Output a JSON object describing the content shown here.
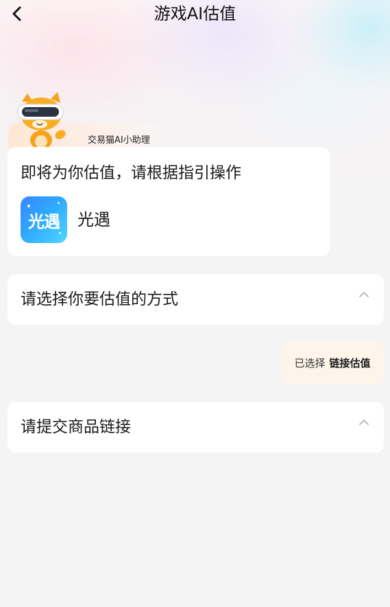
{
  "header": {
    "title": "游戏AI估值",
    "back_icon": "chevron-left-icon"
  },
  "assistant": {
    "name": "交易猫AI小助理",
    "mascot_icon": "mascot-cat-vr-icon"
  },
  "intro_card": {
    "title": "即将为你估值，请根据指引操作",
    "game": {
      "icon_text": "光遇",
      "name": "光遇"
    }
  },
  "method_section": {
    "title": "请选择你要估值的方式",
    "icon": "chevron-up-icon"
  },
  "selection": {
    "prefix": "已选择",
    "value": "链接估值"
  },
  "link_section": {
    "title": "请提交商品链接",
    "icon": "chevron-up-icon"
  },
  "colors": {
    "page_background": "#f4f4f5",
    "card_background": "#ffffff",
    "selection_bubble": "#fdf5ea",
    "game_icon_blue": "#2fa8ff",
    "mascot_orange": "#f7a21b"
  }
}
